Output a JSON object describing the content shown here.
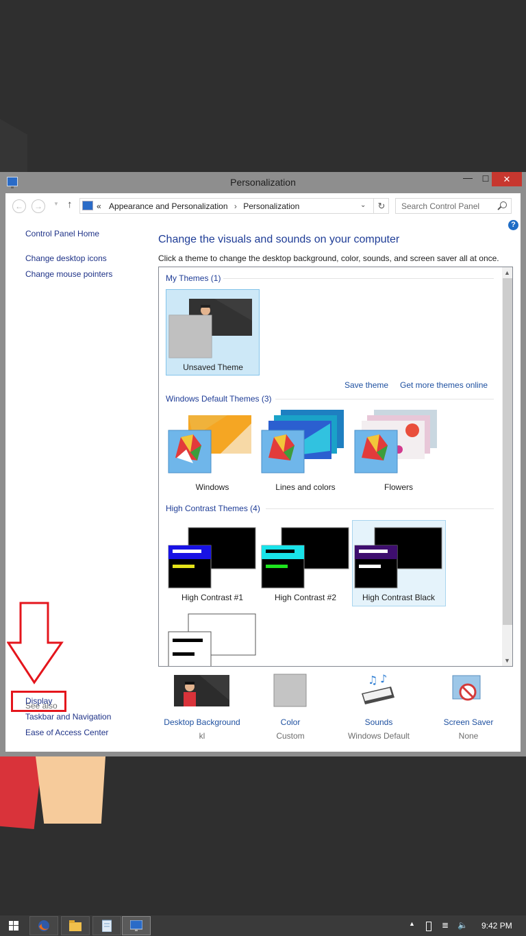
{
  "window": {
    "title": "Personalization",
    "minimize_glyph": "—",
    "maximize_glyph": "☐",
    "close_glyph": "✕"
  },
  "address": {
    "prefix": "«",
    "crumbs": [
      "Appearance and Personalization",
      "Personalization"
    ],
    "separator": "›",
    "search_placeholder": "Search Control Panel"
  },
  "left_nav": {
    "home": "Control Panel Home",
    "links": [
      "Change desktop icons",
      "Change mouse pointers"
    ],
    "see_also_title": "See also",
    "see_also": [
      "Display",
      "Taskbar and Navigation",
      "Ease of Access Center"
    ]
  },
  "main": {
    "heading": "Change the visuals and sounds on your computer",
    "subheading": "Click a theme to change the desktop background, color, sounds, and screen saver all at once.",
    "groups": {
      "my": {
        "title": "My Themes (1)",
        "themes": [
          "Unsaved Theme"
        ]
      },
      "default": {
        "title": "Windows Default Themes (3)",
        "themes": [
          "Windows",
          "Lines and colors",
          "Flowers"
        ]
      },
      "contrast": {
        "title": "High Contrast Themes (4)",
        "themes": [
          "High Contrast #1",
          "High Contrast #2",
          "High Contrast Black"
        ]
      }
    },
    "save_theme": "Save theme",
    "get_more": "Get more themes online"
  },
  "bottom": {
    "items": [
      {
        "label": "Desktop Background",
        "value": "kl"
      },
      {
        "label": "Color",
        "value": "Custom"
      },
      {
        "label": "Sounds",
        "value": "Windows Default"
      },
      {
        "label": "Screen Saver",
        "value": "None"
      }
    ]
  },
  "taskbar": {
    "time": "9:42 PM"
  },
  "colors": {
    "link": "#1e3287",
    "heading": "#1e3c96",
    "close": "#c7372f",
    "annotation": "#e4151c"
  }
}
